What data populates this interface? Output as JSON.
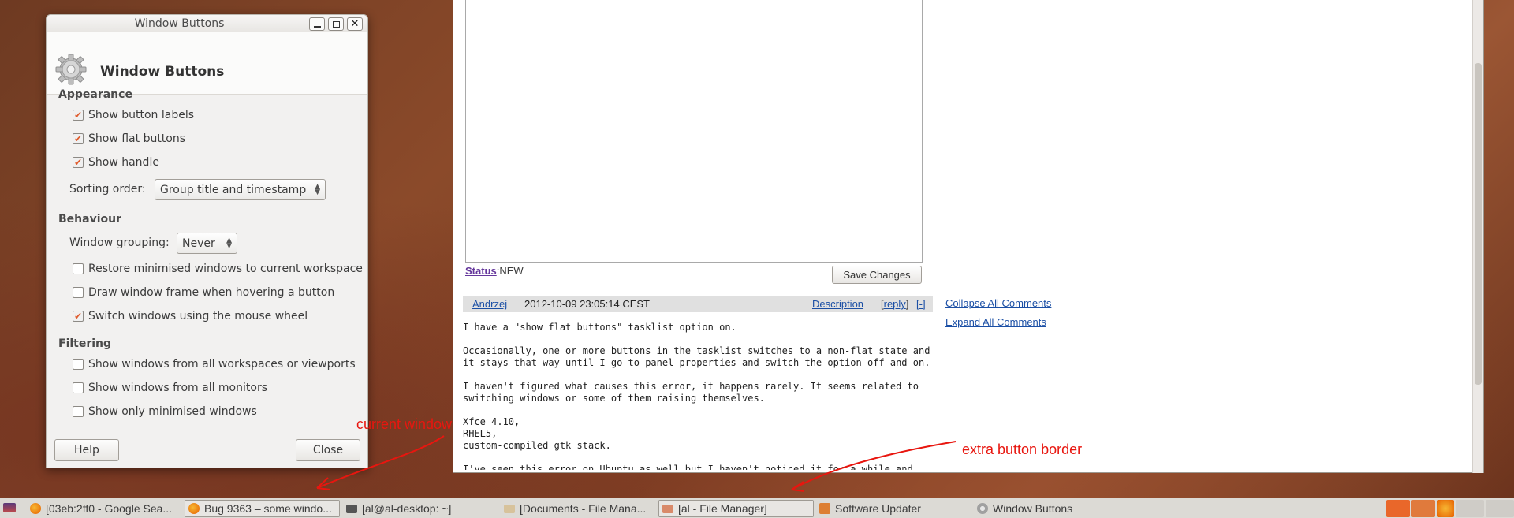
{
  "dialog": {
    "window_title": "Window Buttons",
    "header_title": "Window Buttons",
    "appearance": {
      "title": "Appearance",
      "show_button_labels": {
        "label": "Show button labels",
        "checked": true
      },
      "show_flat_buttons": {
        "label": "Show flat buttons",
        "checked": true
      },
      "show_handle": {
        "label": "Show handle",
        "checked": true
      },
      "sorting_order_label": "Sorting order:",
      "sorting_order_value": "Group title and timestamp"
    },
    "behaviour": {
      "title": "Behaviour",
      "window_grouping_label": "Window grouping:",
      "window_grouping_value": "Never",
      "restore_minimised": {
        "label": "Restore minimised windows to current workspace",
        "checked": false
      },
      "draw_frame": {
        "label": "Draw window frame when hovering a button",
        "checked": false
      },
      "switch_mouse_wheel": {
        "label": "Switch windows using the mouse wheel",
        "checked": true
      }
    },
    "filtering": {
      "title": "Filtering",
      "all_workspaces": {
        "label": "Show windows from all workspaces or viewports",
        "checked": false
      },
      "all_monitors": {
        "label": "Show windows from all monitors",
        "checked": false
      },
      "only_minimised": {
        "label": "Show only minimised windows",
        "checked": false
      }
    },
    "help_label": "Help",
    "close_label": "Close"
  },
  "bug_page": {
    "status_label": "Status",
    "status_value": "NEW",
    "save_label": "Save Changes",
    "comment": {
      "author": "Andrzej",
      "date": "2012-10-09 23:05:14 CEST",
      "description_link": "Description",
      "reply_link": "reply",
      "collapse_link": "[-]",
      "lines": [
        "I have a \"show flat buttons\" tasklist option on.",
        "",
        "Occasionally, one or more buttons in the tasklist switches to a non-flat state and",
        "it stays that way until I go to panel properties and switch the option off and on.",
        "",
        "I haven't figured what causes this error, it happens rarely. It seems related to",
        "switching windows or some of them raising themselves.",
        "",
        "Xfce 4.10,",
        "RHEL5,",
        "custom-compiled gtk stack.",
        "",
        "I've seen this error on Ubuntu as well but I haven't noticed it for a while and"
      ]
    },
    "collapse_all": "Collapse All Comments",
    "expand_all": "Expand All Comments"
  },
  "annotations": {
    "current_window": "current window",
    "extra_border": "extra button border"
  },
  "taskbar": {
    "tasks": [
      {
        "label": "[03eb:2ff0 - Google Sea...",
        "icon": "firefox-icon",
        "color": "#e66000"
      },
      {
        "label": "Bug 9363 – some windo...",
        "icon": "firefox-icon",
        "color": "#e66000"
      },
      {
        "label": "[al@al-desktop: ~]",
        "icon": "terminal-icon",
        "color": "#555555"
      },
      {
        "label": "[Documents - File Mana...",
        "icon": "folder-icon",
        "color": "#d7c29b"
      },
      {
        "label": "[al - File Manager]",
        "icon": "folder-home-icon",
        "color": "#d98a6a"
      },
      {
        "label": "Software Updater",
        "icon": "updater-icon",
        "color": "#dd7f33"
      },
      {
        "label": "Window Buttons",
        "icon": "gear-icon",
        "color": "#a0a0a0"
      }
    ]
  },
  "colors": {
    "accent_orange": "#e05a2b",
    "link_blue": "#1b4fa5",
    "annotation_red": "#e8160f"
  }
}
